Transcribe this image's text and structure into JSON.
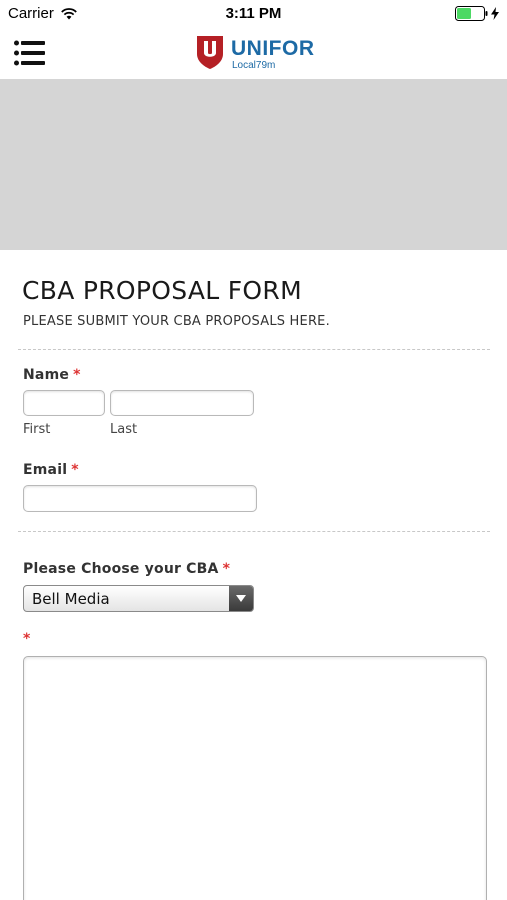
{
  "status_bar": {
    "carrier": "Carrier",
    "time": "3:11 PM",
    "wifi_icon": "wifi-icon",
    "battery_icon": "battery-icon",
    "battery_color": "#4cd964"
  },
  "header": {
    "menu_icon": "hamburger-menu-icon",
    "logo_word": "UNIFOR",
    "logo_sub": "Local79m",
    "brand_blue": "#1d6aa5",
    "brand_red": "#b52025"
  },
  "banner": {
    "color": "#d5d5d5"
  },
  "form": {
    "title": "CBA PROPOSAL FORM",
    "subtitle": "PLEASE SUBMIT YOUR CBA PROPOSALS HERE.",
    "required_marker": "*",
    "name": {
      "label": "Name",
      "first_sublabel": "First",
      "last_sublabel": "Last",
      "first_value": "",
      "last_value": ""
    },
    "email": {
      "label": "Email",
      "value": ""
    },
    "cba": {
      "label": "Please Choose your CBA",
      "selected": "Bell Media"
    },
    "proposal": {
      "value": ""
    }
  }
}
